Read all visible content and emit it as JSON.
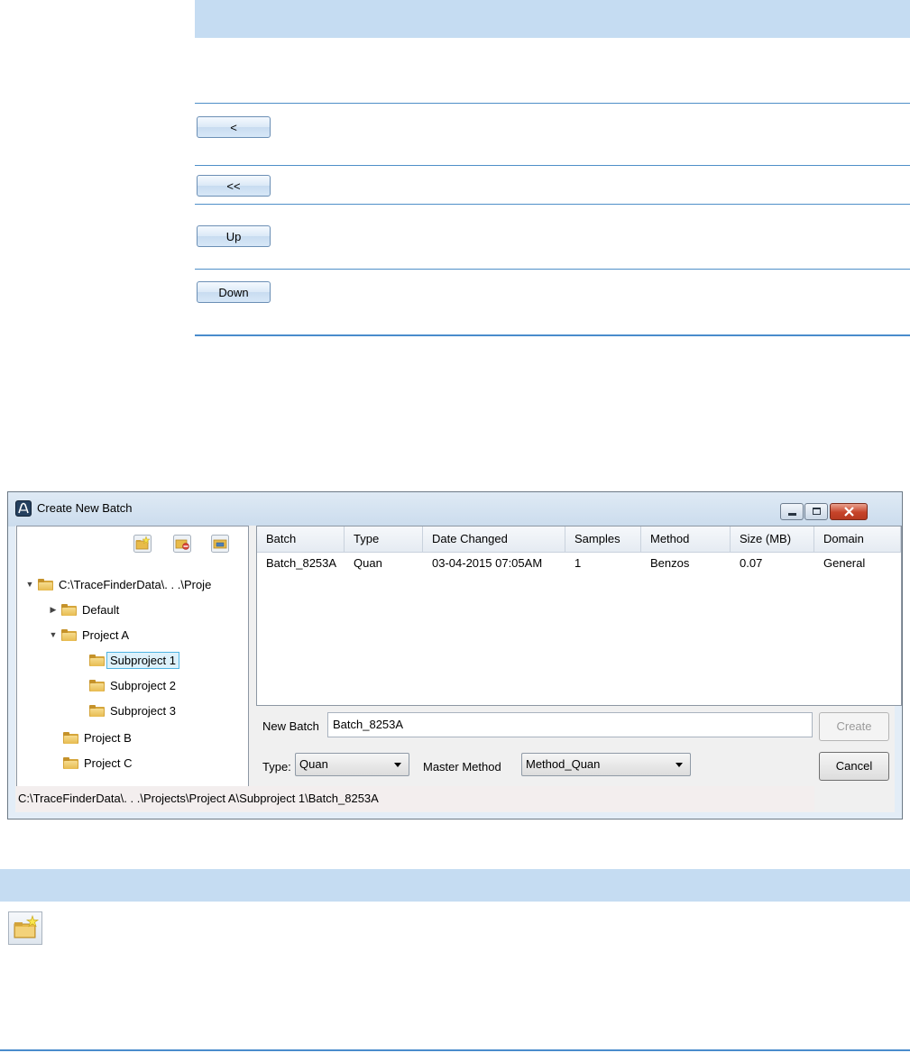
{
  "top_table": {
    "buttons": [
      {
        "label": "<"
      },
      {
        "label": "<<"
      },
      {
        "label": "Up"
      },
      {
        "label": "Down"
      }
    ]
  },
  "dialog": {
    "title": "Create New Batch",
    "title_icon": "app-logo-icon",
    "window_controls": [
      "minimize-icon",
      "maximize-icon",
      "close-icon"
    ],
    "tree_toolbar": [
      "new-folder-icon",
      "delete-folder-icon",
      "rename-folder-icon"
    ],
    "tree": {
      "root": "C:\\TraceFinderData\\. . .\\Proje",
      "items": [
        {
          "label": "Default"
        },
        {
          "label": "Project A"
        },
        {
          "label": "Subproject 1"
        },
        {
          "label": "Subproject 2"
        },
        {
          "label": "Subproject 3"
        },
        {
          "label": "Project B"
        },
        {
          "label": "Project C"
        }
      ]
    },
    "grid": {
      "columns": [
        "Batch",
        "Type",
        "Date Changed",
        "Samples",
        "Method",
        "Size (MB)",
        "Domain"
      ],
      "rows": [
        [
          "Batch_8253A",
          "Quan",
          "03-04-2015 07:05AM",
          "1",
          "Benzos",
          "0.07",
          "General"
        ]
      ]
    },
    "new_batch_label": "New Batch",
    "new_batch_value": "Batch_8253A",
    "create_label": "Create",
    "type_label": "Type:",
    "type_value": "Quan",
    "master_method_label": "Master Method",
    "master_method_value": "Method_Quan",
    "cancel_label": "Cancel",
    "status_path": "C:\\TraceFinderData\\. . .\\Projects\\Project A\\Subproject 1\\Batch_8253A"
  },
  "bottom_table": {
    "icon": "new-folder-icon"
  }
}
